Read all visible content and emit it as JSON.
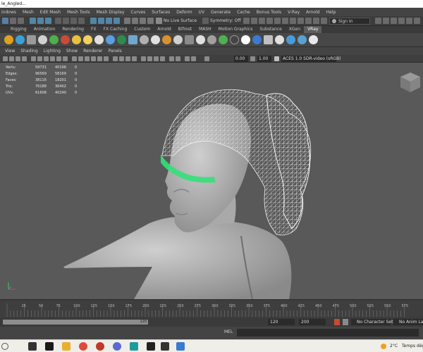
{
  "window": {
    "title": "le_Angled..."
  },
  "menubar": {
    "items": [
      "indows",
      "Mesh",
      "Edit Mesh",
      "Mesh Tools",
      "Mesh Display",
      "Curves",
      "Surfaces",
      "Deform",
      "UV",
      "Generate",
      "Cache",
      "Bonus Tools",
      "V-Ray",
      "Arnold",
      "Help"
    ]
  },
  "statusline": {
    "live_surface": "No Live Surface",
    "symmetry": "Symmetry: Off",
    "sign_in": "Sign In"
  },
  "shelf": {
    "tabs": [
      "Rigging",
      "Animation",
      "Rendering",
      "FX",
      "FX Caching",
      "Custom",
      "Arnold",
      "Bifrost",
      "MASH",
      "Motion Graphics",
      "Substance",
      "XGen",
      "VRay"
    ],
    "active_tab": "VRay"
  },
  "panel": {
    "menu": [
      "View",
      "Shading",
      "Lighting",
      "Show",
      "Renderer",
      "Panels"
    ],
    "field1": "0.00",
    "field2": "1.00",
    "color_space": "ACES 1.0 SDR-video (sRGB)"
  },
  "hud": {
    "rows": [
      {
        "label": "Verts:",
        "v1": "59731",
        "v2": "40196",
        "v3": "0"
      },
      {
        "label": "Edges:",
        "v1": "96569",
        "v2": "58169",
        "v3": "0"
      },
      {
        "label": "Faces:",
        "v1": "38116",
        "v2": "18201",
        "v3": "0"
      },
      {
        "label": "Tris:",
        "v1": "76188",
        "v2": "36402",
        "v3": "0"
      },
      {
        "label": "UVs:",
        "v1": "61608",
        "v2": "40240",
        "v3": "0"
      }
    ]
  },
  "timeline": {
    "ticks": [
      "25",
      "50",
      "75",
      "100",
      "125",
      "150",
      "175",
      "200",
      "225",
      "250",
      "275",
      "300",
      "325",
      "350",
      "375",
      "400",
      "425",
      "450",
      "475",
      "500",
      "525",
      "550",
      "575"
    ],
    "range_end_marker": "120",
    "range_end": "120",
    "anim_end": "200",
    "character_set": "No Character Set",
    "anim_layer": "No Anim Layer"
  },
  "commandline": {
    "language": "MEL"
  },
  "taskbar": {
    "temperature": "2°C",
    "weather": "Temps dég"
  },
  "colors": {
    "accent_blue": "#5285a6",
    "selection_green": "#34e07a",
    "viewport_bg": "#595959"
  }
}
